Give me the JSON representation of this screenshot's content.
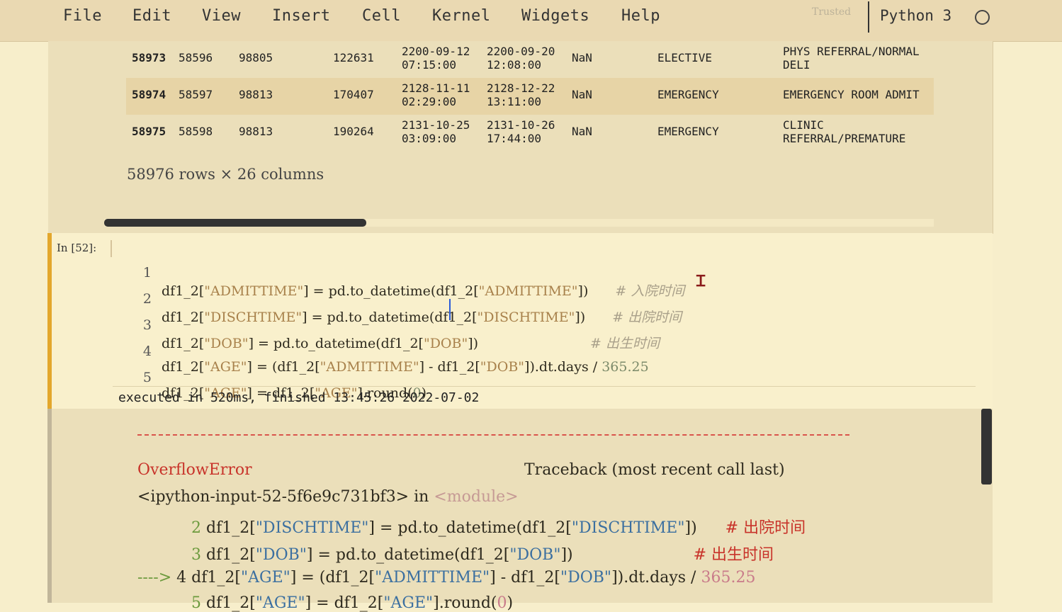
{
  "menubar": {
    "items": [
      "File",
      "Edit",
      "View",
      "Insert",
      "Cell",
      "Kernel",
      "Widgets",
      "Help"
    ],
    "trusted": "Trusted",
    "kernel": "Python 3"
  },
  "dataframe": {
    "rows": [
      {
        "index": "58973",
        "c1": "58596",
        "c2": "98805",
        "c3": "122631",
        "admit": "2200-09-12\n07:15:00",
        "disch": "2200-09-20\n12:08:00",
        "nan": "NaN",
        "type": "ELECTIVE",
        "location": "PHYS REFERRAL/NORMAL\nDELI"
      },
      {
        "index": "58974",
        "c1": "58597",
        "c2": "98813",
        "c3": "170407",
        "admit": "2128-11-11\n02:29:00",
        "disch": "2128-12-22\n13:11:00",
        "nan": "NaN",
        "type": "EMERGENCY",
        "location": "EMERGENCY ROOM ADMIT"
      },
      {
        "index": "58975",
        "c1": "58598",
        "c2": "98813",
        "c3": "190264",
        "admit": "2131-10-25\n03:09:00",
        "disch": "2131-10-26\n17:44:00",
        "nan": "NaN",
        "type": "EMERGENCY",
        "location": "CLINIC\nREFERRAL/PREMATURE"
      }
    ],
    "shape": "58976 rows × 26 columns"
  },
  "cell": {
    "prompt": "In  [52]:",
    "lines": [
      {
        "n": "1",
        "pre": "df1_2[",
        "s1": "\"ADMITTIME\"",
        "mid": "] = pd.to_datetime(df1_2[",
        "s2": "\"ADMITTIME\"",
        "post": "])",
        "comment": "# 入院时间"
      },
      {
        "n": "2",
        "pre": "df1_2[",
        "s1": "\"DISCHTIME\"",
        "mid": "] = pd.to_datetime(df1_2[",
        "s2": "\"DISCHTIME\"",
        "post": "])",
        "comment": "# 出院时间"
      },
      {
        "n": "3",
        "pre": "df1_2[",
        "s1": "\"DOB\"",
        "mid": "] = pd.to_datetime(df1_2[",
        "s2": "\"DOB\"",
        "post": "])",
        "comment": "# 出生时间"
      },
      {
        "n": "4",
        "a": "df1_2[",
        "s1": "\"AGE\"",
        "b": "] = (df1_2[",
        "s2": "\"ADMITTIME\"",
        "c": "] - df1_2[",
        "s3": "\"DOB\"",
        "d": "]).dt.days / ",
        "num": "365.25"
      },
      {
        "n": "5",
        "a": "df1_2[",
        "s1": "\"AGE\"",
        "b": "] = df1_2[",
        "s2": "\"AGE\"",
        "c": "].round(",
        "num": "0",
        "d": ")"
      }
    ],
    "exec_info": "executed in 520ms, finished 13:45:26 2022-07-02"
  },
  "error": {
    "name": "OverflowError",
    "traceback": "Traceback (most recent call last)",
    "location": "<ipython-input-52-5f6e9c731bf3>",
    "in_word": " in ",
    "module": "<module>",
    "lines": [
      {
        "n": "2",
        "pre": "df1_2[",
        "s1": "\"DISCHTIME\"",
        "mid": "] = pd.to_datetime(df1_2[",
        "s2": "\"DISCHTIME\"",
        "post": "])",
        "comment": "# 出院时间"
      },
      {
        "n": "3",
        "pre": "df1_2[",
        "s1": "\"DOB\"",
        "mid": "] = pd.to_datetime(df1_2[",
        "s2": "\"DOB\"",
        "post": "])",
        "comment": "# 出生时间"
      },
      {
        "arrow": "---->",
        "n": "4",
        "a": "df1_2[",
        "s1": "\"AGE\"",
        "b": "] = (df1_2[",
        "s2": "\"ADMITTIME\"",
        "c": "] - df1_2[",
        "s3": "\"DOB\"",
        "d": "]).dt.days / ",
        "num": "365.25"
      },
      {
        "n": "5",
        "a": "df1_2[",
        "s1": "\"AGE\"",
        "b": "] = df1_2[",
        "s2": "\"AGE\"",
        "c": "].round(",
        "num": "0",
        "d": ")"
      }
    ]
  }
}
